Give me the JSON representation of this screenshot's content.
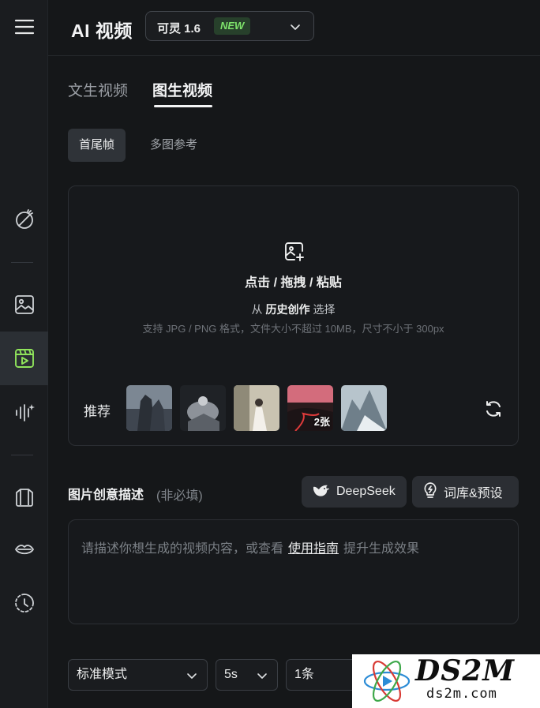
{
  "header": {
    "app_title": "AI 视频",
    "model": "可灵 1.6",
    "badge": "NEW"
  },
  "tabs": [
    {
      "label": "文生视频"
    },
    {
      "label": "图生视频"
    }
  ],
  "subtabs": [
    {
      "label": "首尾帧"
    },
    {
      "label": "多图参考"
    }
  ],
  "upload": {
    "main_text": "点击 / 拖拽 / 粘贴",
    "history_prefix": "从",
    "history_link": "历史创作",
    "history_suffix": "选择",
    "support": "支持 JPG / PNG 格式，文件大小不超过 10MB，尺寸不小于 300px"
  },
  "recommend": {
    "label": "推荐",
    "group_count": "2张"
  },
  "description": {
    "title": "图片创意描述",
    "optional": "(非必填)",
    "deepseek": "DeepSeek",
    "presets": "词库&预设",
    "placeholder_prefix": "请描述你想生成的视频内容，或查看",
    "placeholder_link": "使用指南",
    "placeholder_suffix": "提升生成效果"
  },
  "settings": {
    "mode": "标准模式",
    "duration": "5s",
    "count": "1条"
  },
  "watermark": {
    "main": "DS2M",
    "sub": "ds2m.com"
  },
  "icons": {
    "menu": "menu-icon",
    "magic": "magic-wand-icon",
    "image": "image-icon",
    "video": "video-icon",
    "audio": "audio-wave-icon",
    "shirt": "clothing-icon",
    "lips": "lip-sync-icon",
    "history": "history-icon",
    "upload": "image-add-icon",
    "refresh": "refresh-icon"
  },
  "colors": {
    "accent_green": "#7ee36b",
    "background": "#151719"
  }
}
